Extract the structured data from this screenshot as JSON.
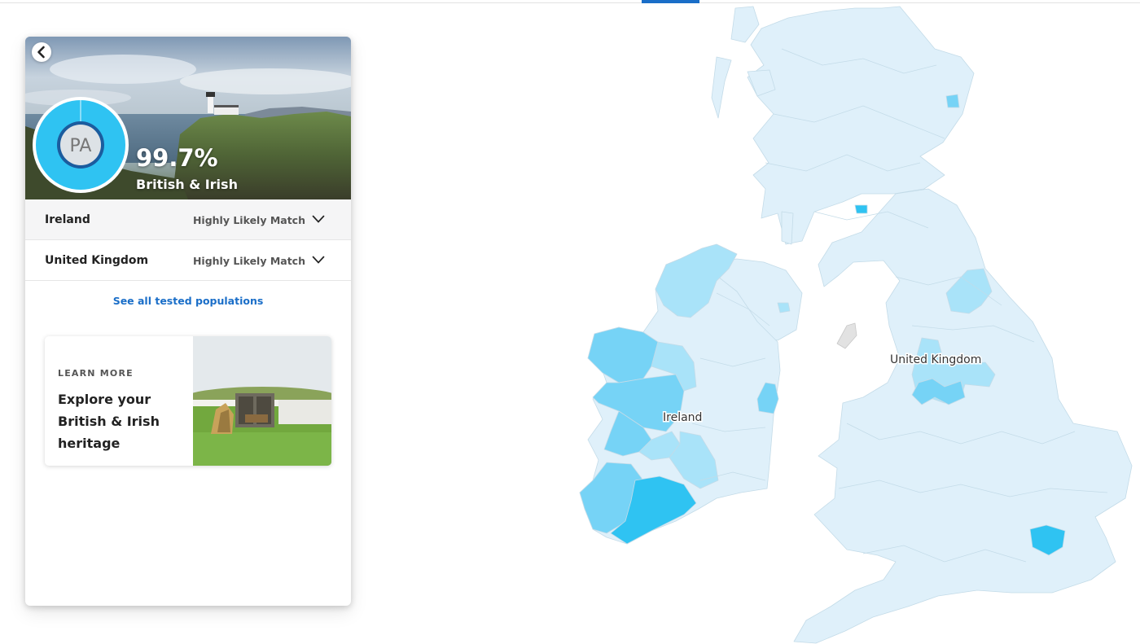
{
  "result": {
    "percentage": "99.7%",
    "name": "British & Irish",
    "avatar_initials": "PA"
  },
  "populations": [
    {
      "country": "Ireland",
      "match": "Highly Likely Match"
    },
    {
      "country": "United Kingdom",
      "match": "Highly Likely Match"
    }
  ],
  "see_all_label": "See all tested populations",
  "learn_more": {
    "label": "LEARN MORE",
    "title": "Explore your British & Irish heritage"
  },
  "map": {
    "labels": {
      "ireland": "Ireland",
      "uk": "United Kingdom"
    },
    "colors": {
      "base": "#dff0fa",
      "light": "#a9e3f9",
      "medium": "#76d3f6",
      "strong": "#2fc3f2",
      "border": "#c3dbe8"
    }
  },
  "colors": {
    "accent": "#1a6ec8",
    "ring_fill": "#2fc3f2",
    "ring_dark": "#1b5c9e"
  },
  "icons": {
    "back": "chevron-left-icon",
    "expand": "chevron-down-icon"
  }
}
